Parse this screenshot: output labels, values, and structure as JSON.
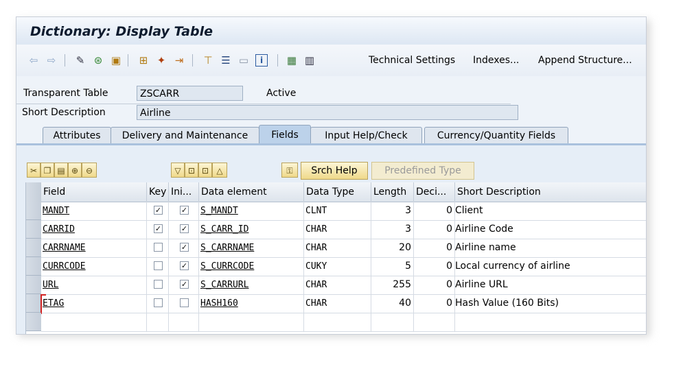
{
  "window": {
    "title": "Dictionary: Display Table"
  },
  "toolbar": {
    "icons": [
      "back-arrow-icon",
      "forward-arrow-icon",
      "glasses-icon",
      "objects-icon",
      "clipboard-icon",
      "hierarchy-icon",
      "magic-wand-icon",
      "export-icon",
      "network-icon",
      "list-icon",
      "window-icon",
      "info-icon",
      "grid-icon",
      "columns-icon"
    ],
    "technical_settings": "Technical Settings",
    "indexes": "Indexes...",
    "append_structure": "Append Structure..."
  },
  "header": {
    "table_type_label": "Transparent Table",
    "table_name": "ZSCARR",
    "status": "Active",
    "short_desc_label": "Short Description",
    "short_desc": "Airline"
  },
  "tabs": [
    {
      "label": "Attributes",
      "active": false
    },
    {
      "label": "Delivery and Maintenance",
      "active": false
    },
    {
      "label": "Fields",
      "active": true
    },
    {
      "label": "Input Help/Check",
      "active": false
    },
    {
      "label": "Currency/Quantity Fields",
      "active": false
    }
  ],
  "actions": {
    "srch_help": "Srch Help",
    "predefined_type": "Predefined Type"
  },
  "columns": {
    "field": "Field",
    "key": "Key",
    "initial": "Ini...",
    "data_element": "Data element",
    "data_type": "Data Type",
    "length": "Length",
    "decimals": "Deci...",
    "short_description": "Short Description"
  },
  "rows": [
    {
      "field": "MANDT",
      "key": true,
      "initial": true,
      "data_element": "S_MANDT",
      "data_type": "CLNT",
      "length": "3",
      "decimals": "0",
      "desc": "Client"
    },
    {
      "field": "CARRID",
      "key": true,
      "initial": true,
      "data_element": "S_CARR_ID",
      "data_type": "CHAR",
      "length": "3",
      "decimals": "0",
      "desc": "Airline Code"
    },
    {
      "field": "CARRNAME",
      "key": false,
      "initial": true,
      "data_element": "S_CARRNAME",
      "data_type": "CHAR",
      "length": "20",
      "decimals": "0",
      "desc": "Airline name"
    },
    {
      "field": "CURRCODE",
      "key": false,
      "initial": true,
      "data_element": "S_CURRCODE",
      "data_type": "CUKY",
      "length": "5",
      "decimals": "0",
      "desc": "Local currency of airline"
    },
    {
      "field": "URL",
      "key": false,
      "initial": true,
      "data_element": "S_CARRURL",
      "data_type": "CHAR",
      "length": "255",
      "decimals": "0",
      "desc": "Airline URL"
    },
    {
      "field": "ETAG",
      "key": false,
      "initial": false,
      "data_element": "HASH160",
      "data_type": "CHAR",
      "length": "40",
      "decimals": "0",
      "desc": "Hash Value (160 Bits)"
    }
  ],
  "colors": {
    "active_tab": "#bcd2ea",
    "button_yellow": "#efd98a",
    "selection_marker": "#d02020"
  }
}
